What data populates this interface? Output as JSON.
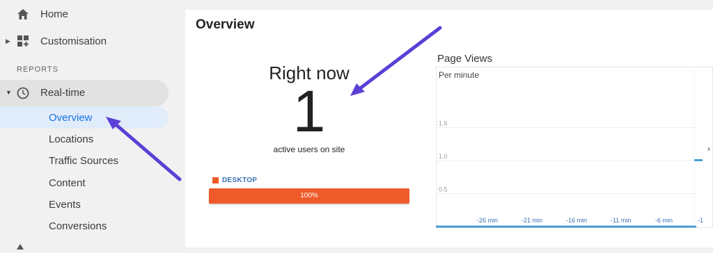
{
  "sidebar": {
    "home_label": "Home",
    "customisation_label": "Customisation",
    "section_reports": "REPORTS",
    "realtime_label": "Real-time",
    "realtime_items": [
      "Overview",
      "Locations",
      "Traffic Sources",
      "Content",
      "Events",
      "Conversions"
    ]
  },
  "main": {
    "title": "Overview",
    "right_now_label": "Right now",
    "active_count": "1",
    "active_users_label": "active users on site",
    "device_legend": "DESKTOP",
    "device_percent_label": "100%",
    "device_share": 1.0
  },
  "chart_data": {
    "type": "bar",
    "title": "Page Views",
    "subtitle": "Per minute",
    "y_ticks": [
      "1.5",
      "1.0",
      "0.5"
    ],
    "ylim": [
      0,
      2
    ],
    "x_tick_labels": [
      "-26 min",
      "-21 min",
      "-16 min",
      "-11 min",
      "-6 min",
      "-1"
    ],
    "series": [
      {
        "values": [
          1
        ]
      }
    ],
    "grid": true
  },
  "colors": {
    "accent_blue": "#1a73e8",
    "desktop_orange": "#ee5a2a",
    "chart_blue": "#4a9fd4",
    "arrow_purple": "#5b3fd6"
  }
}
